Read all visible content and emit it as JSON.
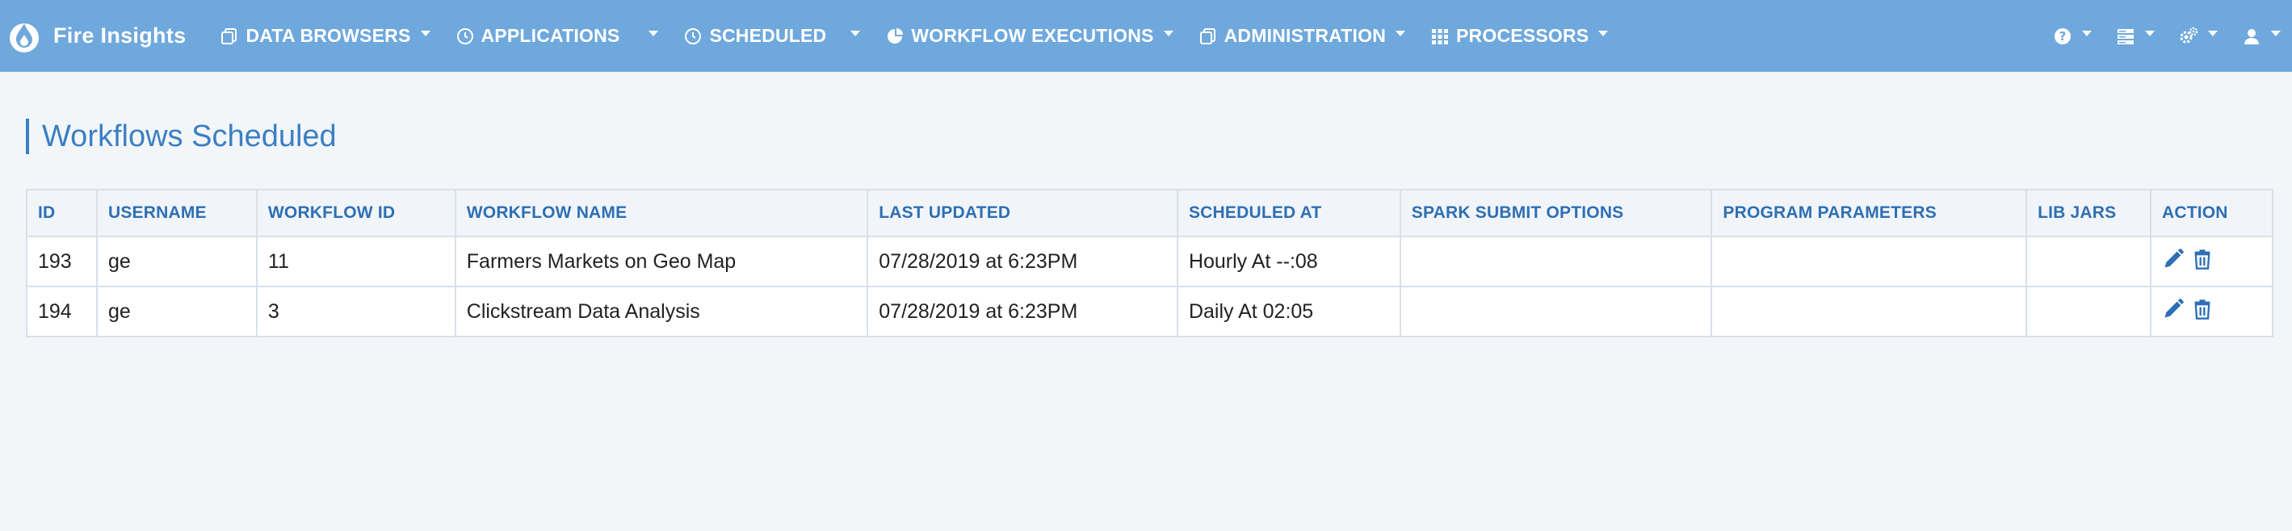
{
  "brand": {
    "name": "Fire Insights"
  },
  "nav": {
    "items": [
      {
        "label": "DATA BROWSERS",
        "icon": "copy-icon"
      },
      {
        "label": "APPLICATIONS",
        "icon": "clock-icon"
      },
      {
        "label": "SCHEDULED",
        "icon": "clock-icon"
      },
      {
        "label": "WORKFLOW EXECUTIONS",
        "icon": "pie-chart-icon"
      },
      {
        "label": "ADMINISTRATION",
        "icon": "copy-icon"
      },
      {
        "label": "PROCESSORS",
        "icon": "grid-icon"
      }
    ],
    "right": [
      {
        "icon": "help-icon"
      },
      {
        "icon": "server-icon"
      },
      {
        "icon": "gears-icon"
      },
      {
        "icon": "user-icon"
      }
    ]
  },
  "page": {
    "title": "Workflows Scheduled"
  },
  "table": {
    "headers": [
      "ID",
      "USERNAME",
      "WORKFLOW ID",
      "WORKFLOW NAME",
      "LAST UPDATED",
      "SCHEDULED AT",
      "SPARK SUBMIT OPTIONS",
      "PROGRAM PARAMETERS",
      "LIB JARS",
      "ACTION"
    ],
    "rows": [
      {
        "id": "193",
        "username": "ge",
        "workflow_id": "11",
        "workflow_name": "Farmers Markets on Geo Map",
        "last_updated": "07/28/2019 at 6:23PM",
        "scheduled_at": "Hourly At --:08",
        "spark_submit_options": "",
        "program_parameters": "",
        "lib_jars": ""
      },
      {
        "id": "194",
        "username": "ge",
        "workflow_id": "3",
        "workflow_name": "Clickstream Data Analysis",
        "last_updated": "07/28/2019 at 6:23PM",
        "scheduled_at": "Daily At 02:05",
        "spark_submit_options": "",
        "program_parameters": "",
        "lib_jars": ""
      }
    ]
  },
  "colors": {
    "navbar": "#6fa8dc",
    "accent": "#3b7fc4",
    "header_text": "#2e6fb3"
  }
}
